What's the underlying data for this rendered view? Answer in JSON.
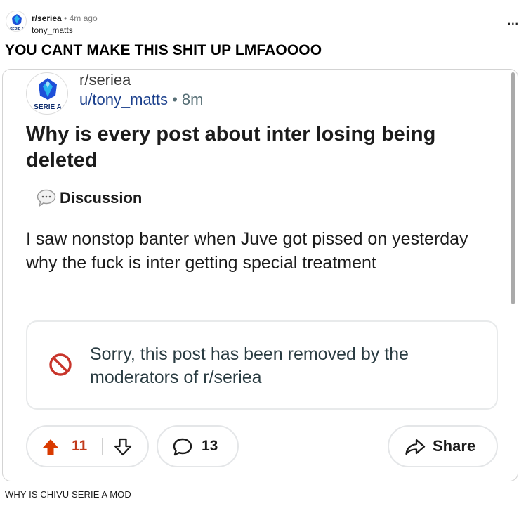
{
  "post": {
    "subreddit": "r/seriea",
    "dot": "•",
    "time": "4m ago",
    "username": "tony_matts",
    "more_label": "...",
    "title": "YOU CANT MAKE THIS SHIT UP LMFAOOOO",
    "caption": "WHY IS CHIVU SERIE A MOD"
  },
  "logo": {
    "text": "SERIE A",
    "colors": {
      "shield": "#1e4fd8",
      "accent": "#28b4ef",
      "text": "#0b2a6b"
    }
  },
  "embedded": {
    "subreddit": "r/seriea",
    "username": "u/tony_matts",
    "dot": "•",
    "time": "8m",
    "title": "Why is every post about inter losing being deleted",
    "flair_icon": "speech-bubble-icon",
    "flair": "Discussion",
    "body": "I saw nonstop banter when Juve got pissed on yesterday why the fuck is inter getting special treatment",
    "removed_notice": "Sorry, this post has been removed by the moderators of r/seriea",
    "removed_icon": "prohibited-icon",
    "votes": "11",
    "comments": "13",
    "share_label": "Share"
  },
  "colors": {
    "upvote": "#d93a00",
    "removed_icon": "#c8352b",
    "link_user": "#1a3f8c"
  }
}
